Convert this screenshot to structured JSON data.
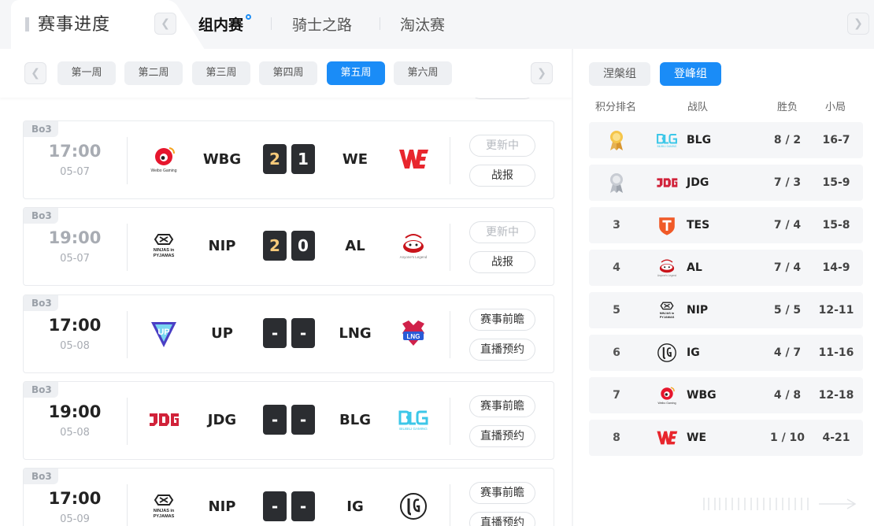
{
  "header": {
    "title": "赛事进度",
    "stage_tabs": [
      {
        "label": "组内赛",
        "active": true
      },
      {
        "label": "骑士之路",
        "active": false
      },
      {
        "label": "淘汰赛",
        "active": false
      }
    ]
  },
  "weeks": {
    "items": [
      "第一周",
      "第二周",
      "第三周",
      "第四周",
      "第五周",
      "第六周"
    ],
    "active_index": 4
  },
  "matches": [
    {
      "format": "Bo3",
      "time": "17:00",
      "date": "05-07",
      "status": "finished",
      "team_a": "WBG",
      "team_a_logo": "wbg-logo",
      "score_a": "2",
      "team_b": "WE",
      "team_b_logo": "we-logo",
      "score_b": "1",
      "winner": "a",
      "btn_top": "更新中",
      "btn_bottom": "战报"
    },
    {
      "format": "Bo3",
      "time": "19:00",
      "date": "05-07",
      "status": "finished",
      "team_a": "NIP",
      "team_a_logo": "nip-logo",
      "score_a": "2",
      "team_b": "AL",
      "team_b_logo": "al-logo",
      "score_b": "0",
      "winner": "a",
      "btn_top": "更新中",
      "btn_bottom": "战报"
    },
    {
      "format": "Bo3",
      "time": "17:00",
      "date": "05-08",
      "status": "upcoming",
      "team_a": "UP",
      "team_a_logo": "up-logo",
      "score_a": "-",
      "team_b": "LNG",
      "team_b_logo": "lng-logo",
      "score_b": "-",
      "winner": "",
      "btn_top": "赛事前瞻",
      "btn_bottom": "直播预约"
    },
    {
      "format": "Bo3",
      "time": "19:00",
      "date": "05-08",
      "status": "upcoming",
      "team_a": "JDG",
      "team_a_logo": "jdg-logo",
      "score_a": "-",
      "team_b": "BLG",
      "team_b_logo": "blg-logo",
      "score_b": "-",
      "winner": "",
      "btn_top": "赛事前瞻",
      "btn_bottom": "直播预约"
    },
    {
      "format": "Bo3",
      "time": "17:00",
      "date": "05-09",
      "status": "upcoming",
      "team_a": "NIP",
      "team_a_logo": "nip-logo",
      "score_a": "-",
      "team_b": "IG",
      "team_b_logo": "ig-logo",
      "score_b": "-",
      "winner": "",
      "btn_top": "赛事前瞻",
      "btn_bottom": "直播预约"
    }
  ],
  "standings": {
    "groups": [
      {
        "label": "涅槃组",
        "active": false
      },
      {
        "label": "登峰组",
        "active": true
      }
    ],
    "headers": {
      "rank": "积分排名",
      "team": "战队",
      "wl": "胜负",
      "games": "小局"
    },
    "rows": [
      {
        "rank": "1",
        "medal": "gold-medal-icon",
        "team": "BLG",
        "logo": "blg-logo",
        "wl": "8 / 2",
        "games": "16-7"
      },
      {
        "rank": "2",
        "medal": "silver-medal-icon",
        "team": "JDG",
        "logo": "jdg-logo",
        "wl": "7 / 3",
        "games": "15-9"
      },
      {
        "rank": "3",
        "medal": "",
        "team": "TES",
        "logo": "tes-logo",
        "wl": "7 / 4",
        "games": "15-8"
      },
      {
        "rank": "4",
        "medal": "",
        "team": "AL",
        "logo": "al-logo",
        "wl": "7 / 4",
        "games": "14-9"
      },
      {
        "rank": "5",
        "medal": "",
        "team": "NIP",
        "logo": "nip-logo",
        "wl": "5 / 5",
        "games": "12-11"
      },
      {
        "rank": "6",
        "medal": "",
        "team": "IG",
        "logo": "ig-logo",
        "wl": "4 / 7",
        "games": "11-16"
      },
      {
        "rank": "7",
        "medal": "",
        "team": "WBG",
        "logo": "wbg-logo",
        "wl": "4 / 8",
        "games": "12-18"
      },
      {
        "rank": "8",
        "medal": "",
        "team": "WE",
        "logo": "we-logo",
        "wl": "1 / 10",
        "games": "4-21"
      }
    ]
  },
  "colors": {
    "accent": "#1a8cf7",
    "win_score": "#f5c97a",
    "score_bg": "#2b2d31",
    "we_red": "#e8262d",
    "blg_cyan": "#3cc7e8",
    "jdg_red": "#d1223a"
  }
}
